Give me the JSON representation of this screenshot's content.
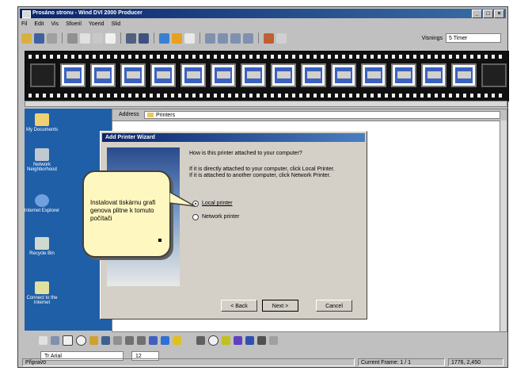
{
  "app": {
    "title": "Prosáno stronu - Wind DVI 2000 Producer",
    "window_controls": [
      "_",
      "□",
      "×"
    ]
  },
  "menu": [
    "Fil",
    "Edit",
    "Vis",
    "Sfoeril",
    "Yoerid",
    "Slid"
  ],
  "toolbar": {
    "zoom_label": "Visnings",
    "zoom_value": "5 Timer"
  },
  "filmstrip": {
    "frame_count": 16
  },
  "explorer": {
    "address_label": "Address",
    "address_value": "Printers"
  },
  "desktop_icons": [
    {
      "label": "My Documents",
      "icon": "folder-icon"
    },
    {
      "label": "Network Neighborhood",
      "icon": "network-icon"
    },
    {
      "label": "Internet Explorer",
      "icon": "internet-icon"
    },
    {
      "label": "Recycle Bin",
      "icon": "recycle-bin-icon"
    },
    {
      "label": "Connect to the Internet",
      "icon": "connect-icon"
    }
  ],
  "wizard": {
    "title": "Add Printer Wizard",
    "question": "How is this printer attached to your computer?",
    "description": "If it is directly attached to your computer, click Local Printer. If it is attached to another computer, click Network Printer.",
    "options": [
      "Local printer",
      "Network printer"
    ],
    "buttons": {
      "back": "< Back",
      "next": "Next >",
      "cancel": "Cancel"
    }
  },
  "callout": {
    "text": "Instalovat tiskárnu grafi genova plitne k tomuto počítači"
  },
  "format": {
    "font": "Tr Arial",
    "size": "12"
  },
  "status": {
    "left": "Připravo",
    "middle": "Current Frame: 1 / 1",
    "right": "1776, 2,450"
  },
  "colors": {
    "titlebar": "#0a246a",
    "desktop": "#1f5fa8",
    "window_face": "#c0c0c0",
    "callout": "#fff7c0"
  }
}
